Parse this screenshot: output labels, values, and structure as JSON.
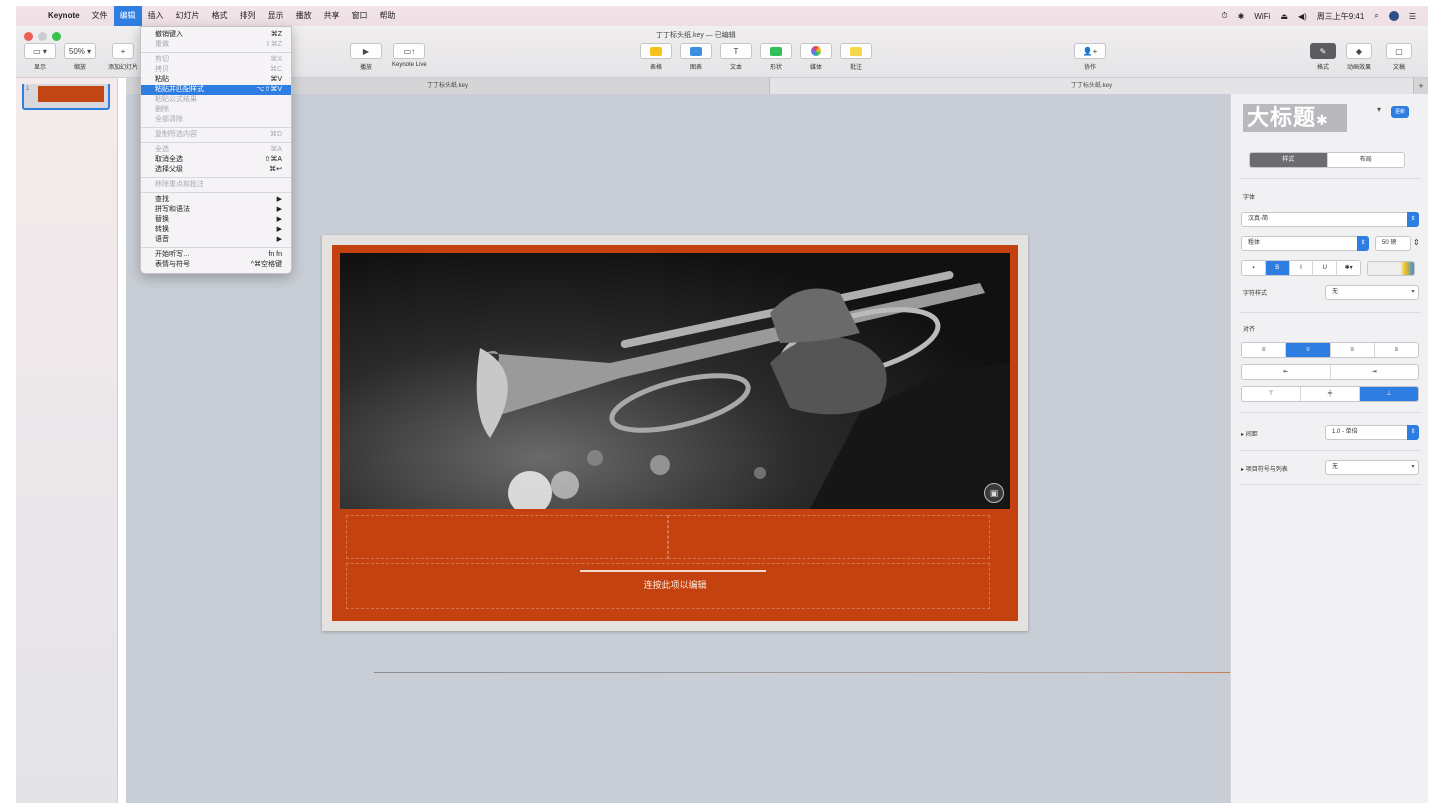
{
  "menubar": {
    "apple": "",
    "app": "Keynote",
    "menus": [
      "文件",
      "编辑",
      "插入",
      "幻灯片",
      "格式",
      "排列",
      "显示",
      "播放",
      "共享",
      "窗口",
      "帮助"
    ],
    "clock": "周三上午9:41",
    "status_icons": [
      "⏱",
      "✱",
      "WiFi",
      "⏏",
      "◀)"
    ]
  },
  "toolbar": {
    "doc_title": "丁丁标头纸.key — 已编辑",
    "view": {
      "icon": "▭ ▾",
      "label": "显示"
    },
    "zoom": {
      "value": "50% ▾",
      "label": "缩放"
    },
    "add_slide": {
      "icon": "+",
      "label": "添加幻灯片"
    },
    "play": {
      "icon": "▶",
      "label": "播放"
    },
    "keynote_live": {
      "icon": "▭↑",
      "label": "Keynote Live"
    },
    "table": {
      "label": "表格"
    },
    "chart": {
      "label": "图表"
    },
    "text": {
      "icon": "T",
      "label": "文本"
    },
    "shape": {
      "label": "形状"
    },
    "media": {
      "label": "媒体"
    },
    "comment": {
      "label": "批注"
    },
    "collaborate": {
      "icon": "👤+",
      "label": "协作"
    },
    "format": {
      "icon": "✎",
      "label": "格式"
    },
    "animate": {
      "icon": "◆",
      "label": "动画效果"
    },
    "document": {
      "icon": "▢",
      "label": "文稿"
    }
  },
  "tabs": [
    "丁丁标头纸.key",
    "丁丁标头纸.key"
  ],
  "navigator": {
    "slide_number": "1"
  },
  "slide": {
    "body_text": "连按此项以编辑",
    "media_icon": "▣"
  },
  "inspector": {
    "style_preview": "大标题",
    "update_btn": "更新",
    "tabs": [
      "样式",
      "布局"
    ],
    "font_label": "字体",
    "font_name": "汉真-简",
    "font_weight": "粗体",
    "font_size": "50 磅",
    "char_style_label": "字符样式",
    "char_style_value": "无",
    "align_label": "对齐",
    "spacing_label": "间距",
    "spacing_value": "1.0 - 单倍",
    "bullets_label": "项目符号与列表",
    "bullets_value": "无",
    "style_buttons": [
      "▪",
      "B",
      "I",
      "U",
      "✱▾"
    ],
    "align_buttons": [
      "≡",
      "≡",
      "≡",
      "≡"
    ],
    "indent_buttons": [
      "⇤",
      "⇥"
    ],
    "valign_buttons": [
      "⊤",
      "╪",
      "⊥"
    ]
  },
  "editmenu": {
    "items": [
      {
        "label": "撤销键入",
        "shortcut": "⌘Z",
        "state": "normal"
      },
      {
        "label": "重做",
        "shortcut": "⇧⌘Z",
        "state": "disabled"
      },
      {
        "sep": true
      },
      {
        "label": "剪切",
        "shortcut": "⌘X",
        "state": "disabled"
      },
      {
        "label": "拷贝",
        "shortcut": "⌘C",
        "state": "disabled"
      },
      {
        "label": "粘贴",
        "shortcut": "⌘V",
        "state": "normal"
      },
      {
        "label": "粘贴并匹配样式",
        "shortcut": "⌥⇧⌘V",
        "state": "highlight"
      },
      {
        "label": "粘贴公式结果",
        "shortcut": "",
        "state": "disabled"
      },
      {
        "label": "删除",
        "shortcut": "",
        "state": "disabled"
      },
      {
        "label": "全部清除",
        "shortcut": "",
        "state": "disabled"
      },
      {
        "sep": true
      },
      {
        "label": "复制所选内容",
        "shortcut": "⌘D",
        "state": "disabled"
      },
      {
        "sep": true
      },
      {
        "label": "全选",
        "shortcut": "⌘A",
        "state": "disabled"
      },
      {
        "label": "取消全选",
        "shortcut": "⇧⌘A",
        "state": "normal"
      },
      {
        "label": "选择父级",
        "shortcut": "⌘↩",
        "state": "normal"
      },
      {
        "sep": true
      },
      {
        "label": "移除重点和批注",
        "shortcut": "",
        "state": "disabled"
      },
      {
        "sep": true
      },
      {
        "label": "查找",
        "shortcut": "▶",
        "state": "normal"
      },
      {
        "label": "拼写和语法",
        "shortcut": "▶",
        "state": "normal"
      },
      {
        "label": "替换",
        "shortcut": "▶",
        "state": "normal"
      },
      {
        "label": "转换",
        "shortcut": "▶",
        "state": "normal"
      },
      {
        "label": "语音",
        "shortcut": "▶",
        "state": "normal"
      },
      {
        "sep": true
      },
      {
        "label": "开始听写…",
        "shortcut": "fn fn",
        "state": "normal"
      },
      {
        "label": "表情与符号",
        "shortcut": "^⌘空格键",
        "state": "normal"
      }
    ]
  },
  "colors": {
    "accent": "#2e7de0",
    "slide_orange": "#c4420f",
    "canvas": "#c9ced6"
  }
}
